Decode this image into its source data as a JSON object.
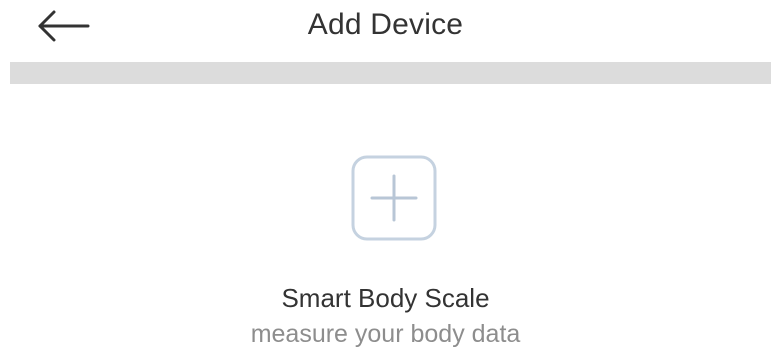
{
  "header": {
    "back_icon": "arrow-left-icon",
    "title": "Add Device"
  },
  "device": {
    "add_icon": "plus-icon",
    "name": "Smart Body Scale",
    "description": "measure your body data"
  },
  "colors": {
    "title_text": "#333333",
    "secondary_text": "#8d8d8d",
    "divider": "#dcdcdc",
    "add_tile_border": "#c5d2e0",
    "add_tile_plus": "#b8c6d6"
  }
}
